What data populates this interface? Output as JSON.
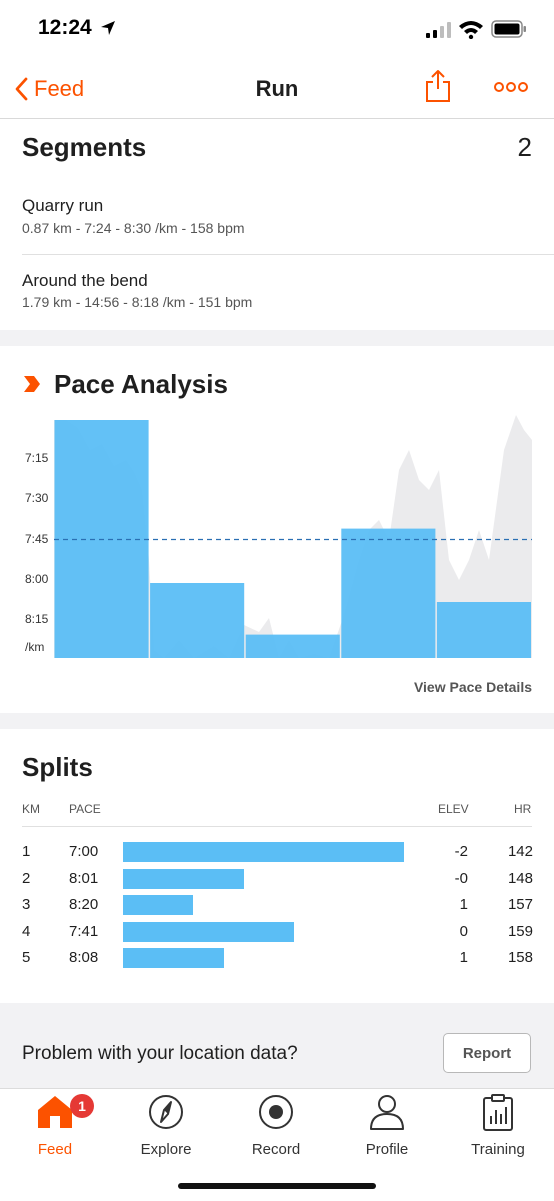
{
  "status_bar": {
    "time": "12:24"
  },
  "nav": {
    "back_label": "Feed",
    "title": "Run",
    "share_icon": "share-icon",
    "more_icon": "more-icon"
  },
  "segments": {
    "title": "Segments",
    "count": "2",
    "items": [
      {
        "name": "Quarry run",
        "stats": "0.87 km - 7:24 - 8:30 /km - 158 bpm"
      },
      {
        "name": "Around the bend",
        "stats": "1.79 km - 14:56 - 8:18 /km - 151 bpm"
      }
    ]
  },
  "pace_analysis": {
    "title": "Pace Analysis",
    "link": "View Pace Details",
    "colors": {
      "bar": "#5bbef5",
      "area": "#ebebed",
      "avg_line": "#2a6fb3"
    }
  },
  "chart_data": {
    "type": "bar",
    "title": "Pace Analysis",
    "ylabel": "/km",
    "y_ticks": [
      "7:15",
      "7:30",
      "7:45",
      "8:00",
      "8:15"
    ],
    "y_unit_label": "/km",
    "categories": [
      "1",
      "2",
      "3",
      "4",
      "5"
    ],
    "values": [
      "7:00",
      "8:01",
      "8:20",
      "7:41",
      "8:08"
    ],
    "values_seconds_per_km": [
      420,
      481,
      500,
      461,
      488
    ],
    "average_line": "7:45",
    "average_line_seconds_per_km": 465,
    "y_axis_inverted": true,
    "grid": false
  },
  "splits": {
    "title": "Splits",
    "headers": {
      "km": "KM",
      "pace": "PACE",
      "elev": "ELEV",
      "hr": "HR"
    },
    "rows": [
      {
        "km": "1",
        "pace": "7:00",
        "elev": "-2",
        "hr": "142",
        "bar_fraction": 1.0
      },
      {
        "km": "2",
        "pace": "8:01",
        "elev": "-0",
        "hr": "148",
        "bar_fraction": 0.43
      },
      {
        "km": "3",
        "pace": "8:20",
        "elev": "1",
        "hr": "157",
        "bar_fraction": 0.25
      },
      {
        "km": "4",
        "pace": "7:41",
        "elev": "0",
        "hr": "159",
        "bar_fraction": 0.61
      },
      {
        "km": "5",
        "pace": "8:08",
        "elev": "1",
        "hr": "158",
        "bar_fraction": 0.36
      }
    ]
  },
  "location_problem": {
    "text": "Problem with your location data?",
    "button": "Report"
  },
  "tab_bar": {
    "items": [
      {
        "label": "Feed",
        "icon": "home-icon",
        "active": true
      },
      {
        "label": "Explore",
        "icon": "compass-icon",
        "active": false
      },
      {
        "label": "Record",
        "icon": "record-icon",
        "active": false
      },
      {
        "label": "Profile",
        "icon": "profile-icon",
        "active": false
      },
      {
        "label": "Training",
        "icon": "training-icon",
        "active": false
      }
    ],
    "badge": "1",
    "accent": "#fc5200"
  }
}
